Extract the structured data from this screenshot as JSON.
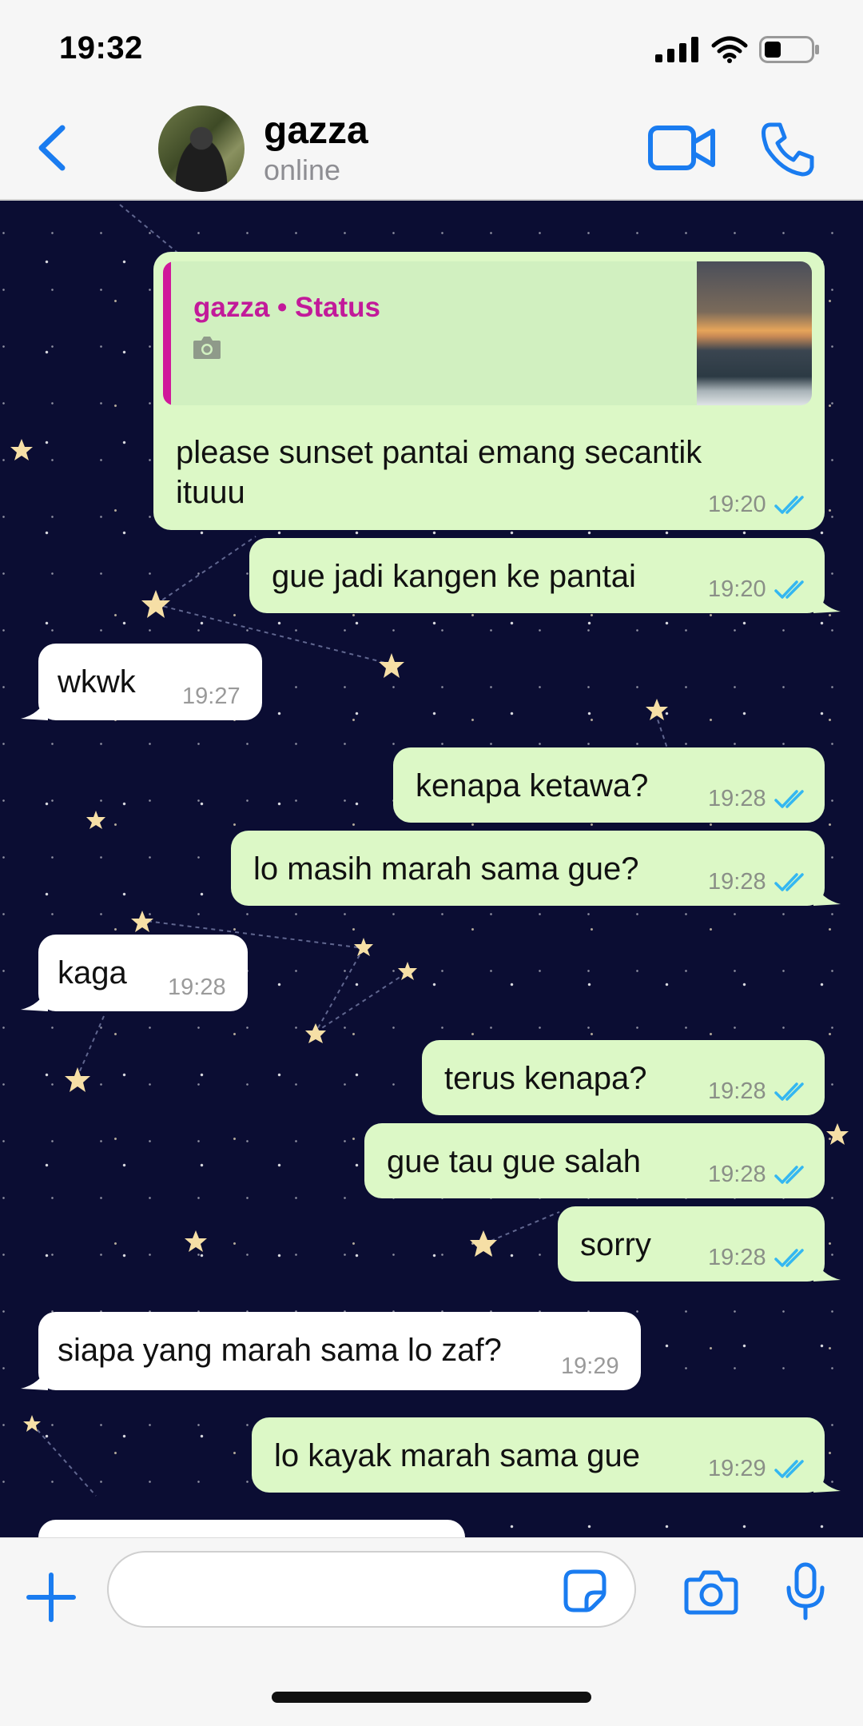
{
  "status_bar": {
    "time": "19:32"
  },
  "header": {
    "contact_name": "gazza",
    "contact_status": "online",
    "icons": [
      "back-chevron-icon",
      "video-call-icon",
      "phone-icon"
    ]
  },
  "messages": [
    {
      "direction": "outgoing",
      "reply": {
        "title": "gazza • Status",
        "media_icon": "camera-icon"
      },
      "text_lines": [
        "please sunset pantai emang secantik",
        "ituuu"
      ],
      "time": "19:20",
      "status": "read"
    },
    {
      "direction": "outgoing",
      "text": "gue jadi kangen ke pantai",
      "time": "19:20",
      "status": "read"
    },
    {
      "direction": "incoming",
      "text": "wkwk",
      "time": "19:27"
    },
    {
      "direction": "outgoing",
      "text": "kenapa ketawa?",
      "time": "19:28",
      "status": "read"
    },
    {
      "direction": "outgoing",
      "text": "lo masih marah sama gue?",
      "time": "19:28",
      "status": "read"
    },
    {
      "direction": "incoming",
      "text": "kaga",
      "time": "19:28"
    },
    {
      "direction": "outgoing",
      "text": "terus kenapa?",
      "time": "19:28",
      "status": "read"
    },
    {
      "direction": "outgoing",
      "text": "gue tau gue salah",
      "time": "19:28",
      "status": "read"
    },
    {
      "direction": "outgoing",
      "text": "sorry",
      "time": "19:28",
      "status": "read"
    },
    {
      "direction": "incoming",
      "text": "siapa yang marah sama lo zaf?",
      "time": "19:29"
    },
    {
      "direction": "outgoing",
      "text": "lo kayak marah sama gue",
      "time": "19:29",
      "status": "read"
    }
  ],
  "input_bar": {
    "value": "",
    "icons": [
      "plus-icon",
      "sticker-icon",
      "camera-icon",
      "microphone-icon"
    ]
  },
  "colors": {
    "accent": "#1a7cf0",
    "outgoing_bubble": "#dcf8c6",
    "incoming_bubble": "#ffffff",
    "read_ticks": "#34b7f1",
    "reply_accent": "#c21a9a",
    "chat_background": "#0b0d33"
  }
}
